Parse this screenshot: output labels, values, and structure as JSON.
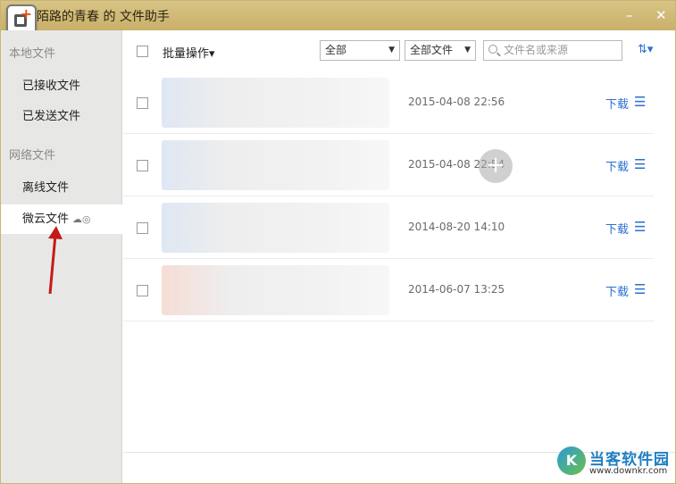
{
  "window": {
    "title": "陌路的青春 的 文件助手",
    "minimize_label": "–",
    "close_label": "✕"
  },
  "sidebar": {
    "section_local": "本地文件",
    "section_network": "网络文件",
    "items": [
      {
        "label": "已接收文件"
      },
      {
        "label": "已发送文件"
      },
      {
        "label": "离线文件"
      },
      {
        "label": "微云文件"
      }
    ]
  },
  "toolbar": {
    "batch_label": "批量操作▾",
    "filter_scope": "全部",
    "filter_type": "全部文件",
    "search_placeholder": "文件名或来源",
    "sort_label": "⇅▾"
  },
  "files": [
    {
      "date": "2015-04-08 22:56",
      "download": "下载",
      "thumb": "blue"
    },
    {
      "date": "2015-04-08 22:54",
      "download": "下载",
      "thumb": "blue"
    },
    {
      "date": "2014-08-20 14:10",
      "download": "下载",
      "thumb": "blue"
    },
    {
      "date": "2014-06-07 13:25",
      "download": "下载",
      "thumb": "red"
    }
  ],
  "watermark": {
    "brand": "当客软件园",
    "url": "www.downkr.com"
  },
  "colors": {
    "title_bar": "#cdb572",
    "link_blue": "#2a6fd1",
    "arrow_red": "#c41a1a"
  }
}
